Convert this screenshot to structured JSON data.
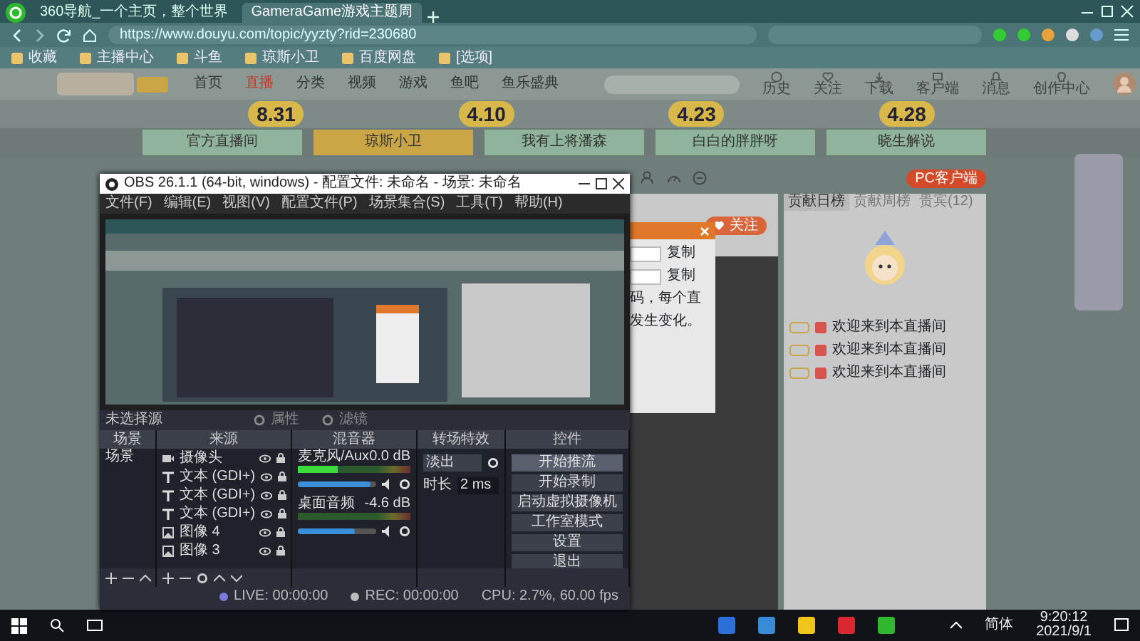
{
  "browser": {
    "tabs": [
      {
        "title": "360导航_一个主页，整个世界",
        "selected": false
      },
      {
        "title": "GameraGame游戏主题周",
        "selected": true
      }
    ],
    "address": "https://www.douyu.com/topic/yyzty?rid=230680",
    "bookmarks": [
      "收藏",
      "主播中心",
      "斗鱼",
      "琼斯小卫",
      "百度网盘",
      "[选项]"
    ]
  },
  "site": {
    "nav": [
      {
        "label": "首页",
        "selected": false
      },
      {
        "label": "直播",
        "selected": true
      },
      {
        "label": "分类",
        "selected": false
      },
      {
        "label": "视频",
        "selected": false
      },
      {
        "label": "游戏",
        "selected": false
      },
      {
        "label": "鱼吧",
        "selected": false
      },
      {
        "label": "鱼乐盛典",
        "selected": false
      }
    ],
    "actions": [
      "历史",
      "关注",
      "下载",
      "客户端",
      "消息",
      "创作中心"
    ],
    "dates": [
      "8.31",
      "4.10",
      "4.23",
      "4.28"
    ],
    "rooms": [
      {
        "label": "官方直播间",
        "selected": false
      },
      {
        "label": "琼斯小卫",
        "selected": true
      },
      {
        "label": "我有上将潘森",
        "selected": false
      },
      {
        "label": "白白的胖胖呀",
        "selected": false
      },
      {
        "label": "晓生解说",
        "selected": false
      }
    ]
  },
  "room": {
    "client_button": "PC客户端",
    "follow": "关注",
    "dialog": {
      "copy_labels": [
        "复制",
        "复制"
      ],
      "notes": [
        "码，每个直",
        "发生变化。"
      ]
    },
    "chat": {
      "tabs": [
        {
          "label": "贡献日榜",
          "selected": true
        },
        {
          "label": "贡献周榜",
          "selected": false
        },
        {
          "label": "贵宾(12)",
          "selected": false
        }
      ],
      "messages": [
        "欢迎来到本直播间",
        "欢迎来到本直播间",
        "欢迎来到本直播间"
      ]
    }
  },
  "obs": {
    "title": "OBS 26.1.1 (64-bit, windows) - 配置文件: 未命名 - 场景: 未命名",
    "menu": [
      "文件(F)",
      "编辑(E)",
      "视图(V)",
      "配置文件(P)",
      "场景集合(S)",
      "工具(T)",
      "帮助(H)"
    ],
    "no_source": "未选择源",
    "source_buttons": [
      "属性",
      "滤镜"
    ],
    "docks": [
      "场景",
      "来源",
      "混音器",
      "转场特效",
      "控件"
    ],
    "scenes": [
      "场景"
    ],
    "sources": [
      {
        "kind": "camera",
        "name": "摄像头"
      },
      {
        "kind": "text",
        "name": "文本 (GDI+)"
      },
      {
        "kind": "text",
        "name": "文本 (GDI+)"
      },
      {
        "kind": "text",
        "name": "文本 (GDI+)"
      },
      {
        "kind": "image",
        "name": "图像 4"
      },
      {
        "kind": "image",
        "name": "图像 3"
      }
    ],
    "mixer": [
      {
        "name": "麦克风/Aux",
        "reading": "0.0 dB",
        "meter": {
          "level": 0.35
        },
        "volume": {
          "level": 0.92
        }
      },
      {
        "name": "桌面音频",
        "reading": "-4.6 dB",
        "meter": {
          "level": 0
        },
        "volume": {
          "level": 0.72
        }
      }
    ],
    "transition": {
      "type": "淡出",
      "duration_label": "时长",
      "duration": "2 ms"
    },
    "controls": [
      {
        "label": "开始推流",
        "hovered": true
      },
      {
        "label": "开始录制",
        "hovered": false
      },
      {
        "label": "启动虚拟摄像机",
        "hovered": false
      },
      {
        "label": "工作室模式",
        "hovered": false
      },
      {
        "label": "设置",
        "hovered": false
      },
      {
        "label": "退出",
        "hovered": false
      }
    ],
    "status": [
      "LIVE: 00:00:00",
      "REC: 00:00:00",
      "CPU: 2.7%, 60.00 fps"
    ]
  },
  "taskbar": {
    "ime": "简体",
    "time": "9:20:12",
    "date": "2021/9/1"
  }
}
